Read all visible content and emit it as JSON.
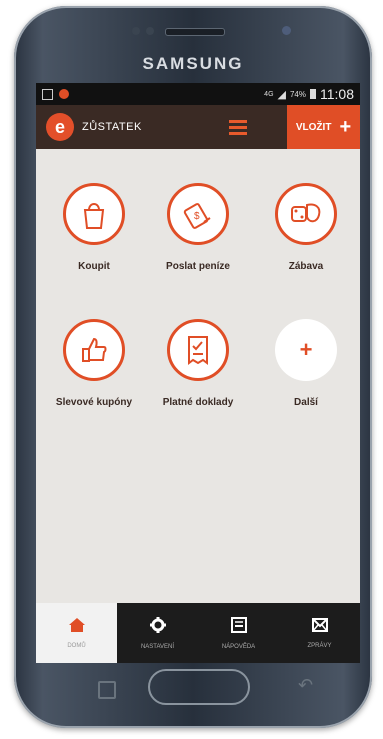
{
  "device": {
    "brand": "SAMSUNG"
  },
  "status_bar": {
    "network": "4G",
    "battery": "74%",
    "time": "11:08"
  },
  "header": {
    "balance_label": "ZŮSTATEK",
    "deposit_label": "VLOŽIT",
    "deposit_plus": "+"
  },
  "tiles": [
    {
      "label": "Koupit",
      "icon": "shopping-bag-icon"
    },
    {
      "label": "Poslat peníze",
      "icon": "send-money-icon"
    },
    {
      "label": "Zábava",
      "icon": "entertainment-icon"
    },
    {
      "label": "Slevové kupóny",
      "icon": "thumbs-up-icon"
    },
    {
      "label": "Platné doklady",
      "icon": "receipt-icon"
    },
    {
      "label": "Další",
      "icon": "plus-icon",
      "symbol": "+"
    }
  ],
  "tabs": [
    {
      "label": "DOMŮ",
      "icon": "home-icon",
      "active": true
    },
    {
      "label": "NASTAVENÍ",
      "icon": "gear-icon"
    },
    {
      "label": "NÁPOVĚDA",
      "icon": "help-book-icon"
    },
    {
      "label": "ZPRÁVY",
      "icon": "envelope-icon"
    }
  ],
  "colors": {
    "accent": "#e04e26",
    "header_bg": "#3a2a24",
    "screen_bg": "#e8e6e3"
  }
}
